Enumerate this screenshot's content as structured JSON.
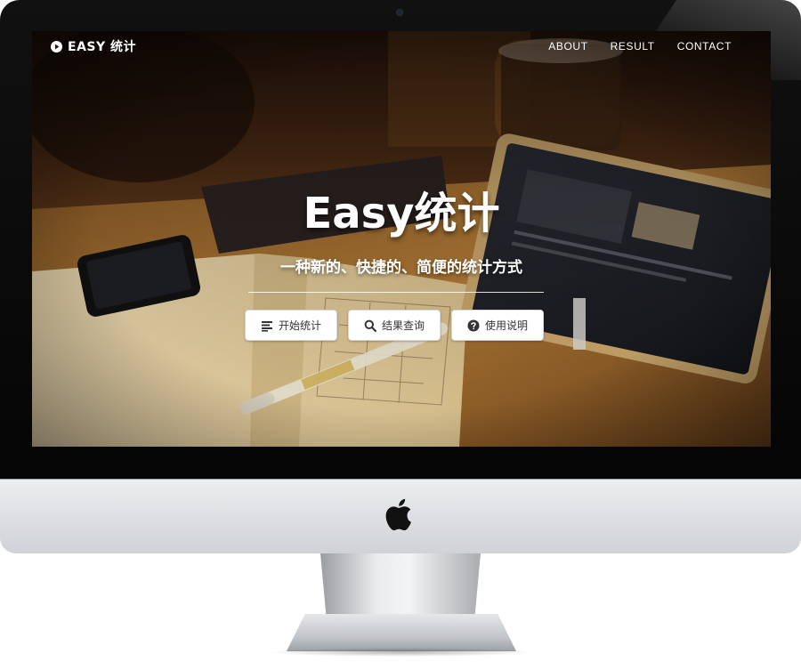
{
  "nav": {
    "brand": "EASY 统计",
    "links": [
      {
        "label": "ABOUT"
      },
      {
        "label": "RESULT"
      },
      {
        "label": "CONTACT"
      }
    ]
  },
  "hero": {
    "title": "Easy统计",
    "subtitle": "一种新的、快捷的、简便的统计方式"
  },
  "actions": [
    {
      "label": "开始统计",
      "icon": "align-left-icon"
    },
    {
      "label": "结果查询",
      "icon": "search-icon"
    },
    {
      "label": "使用说明",
      "icon": "question-circle-icon"
    }
  ],
  "colors": {
    "button_bg": "#ffffff",
    "button_text": "#333333",
    "nav_text": "#ffffff"
  }
}
